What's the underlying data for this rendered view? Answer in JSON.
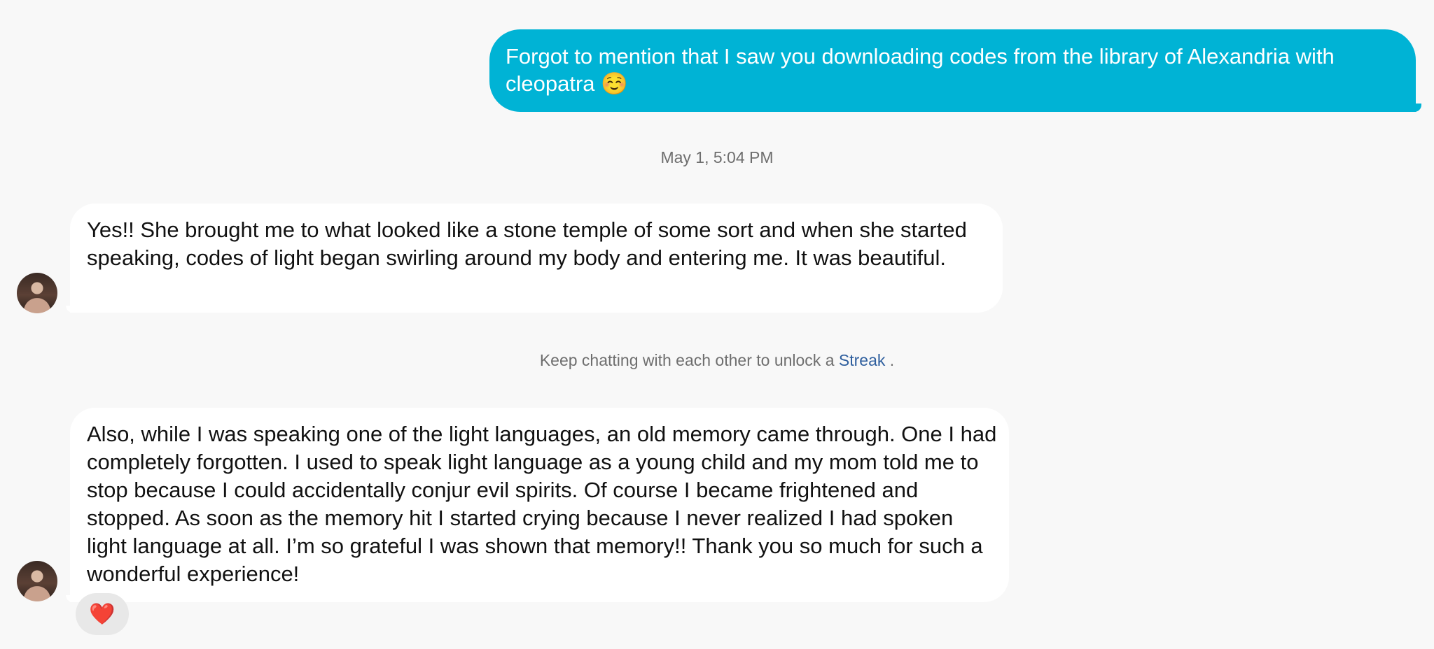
{
  "outgoing_message": {
    "text": "Forgot to mention that I saw you downloading codes from the library of Alexandria with cleopatra ☺️"
  },
  "timestamp": "May 1, 5:04 PM",
  "incoming_messages": [
    {
      "text": "Yes!! She brought me to what looked like a stone temple of some sort and when she started speaking, codes of light began swirling around my body and entering me. It was beautiful."
    },
    {
      "text": "Also, while I was speaking one of the light languages, an old memory came through. One I had completely forgotten. I used to speak light language as a young child and my mom told me to stop because I could accidentally conjur evil spirits. Of course I became frightened and stopped. As soon as the memory hit I started crying because I never realized I had spoken light language at all. I’m so grateful I was shown that memory!! Thank you so much for such a wonderful experience!"
    }
  ],
  "streak_notice": {
    "prefix": "Keep chatting with each other to unlock a ",
    "link": "Streak",
    "suffix": " ."
  },
  "reaction": {
    "emoji": "❤️",
    "icon": "heart-icon"
  },
  "colors": {
    "background": "#f8f8f8",
    "outgoing_bubble": "#00b3d5",
    "incoming_bubble": "#ffffff",
    "link": "#2f5f9e",
    "muted_text": "#6e6e6e"
  }
}
